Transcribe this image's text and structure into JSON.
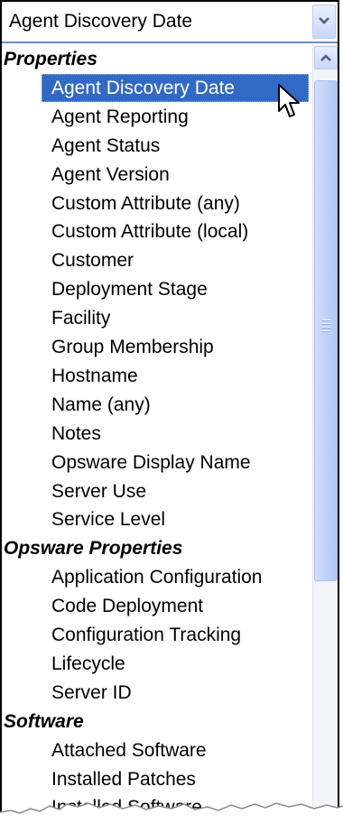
{
  "combo": {
    "value": "Agent Discovery Date"
  },
  "list": {
    "items": [
      {
        "type": "group",
        "label": "Properties"
      },
      {
        "type": "option",
        "label": "Agent Discovery Date",
        "selected": true
      },
      {
        "type": "option",
        "label": "Agent Reporting"
      },
      {
        "type": "option",
        "label": "Agent Status"
      },
      {
        "type": "option",
        "label": "Agent Version"
      },
      {
        "type": "option",
        "label": "Custom Attribute (any)"
      },
      {
        "type": "option",
        "label": "Custom Attribute (local)"
      },
      {
        "type": "option",
        "label": "Customer"
      },
      {
        "type": "option",
        "label": "Deployment Stage"
      },
      {
        "type": "option",
        "label": "Facility"
      },
      {
        "type": "option",
        "label": "Group Membership"
      },
      {
        "type": "option",
        "label": "Hostname"
      },
      {
        "type": "option",
        "label": "Name (any)"
      },
      {
        "type": "option",
        "label": "Notes"
      },
      {
        "type": "option",
        "label": "Opsware Display Name"
      },
      {
        "type": "option",
        "label": "Server Use"
      },
      {
        "type": "option",
        "label": "Service Level"
      },
      {
        "type": "group",
        "label": "Opsware Properties"
      },
      {
        "type": "option",
        "label": "Application Configuration"
      },
      {
        "type": "option",
        "label": "Code Deployment"
      },
      {
        "type": "option",
        "label": "Configuration Tracking"
      },
      {
        "type": "option",
        "label": "Lifecycle"
      },
      {
        "type": "option",
        "label": "Server ID"
      },
      {
        "type": "group",
        "label": "Software"
      },
      {
        "type": "option",
        "label": "Attached Software"
      },
      {
        "type": "option",
        "label": "Installed Patches"
      },
      {
        "type": "option",
        "label": "Installed Software"
      }
    ]
  },
  "icons": {
    "combo_button": "chevron-down-icon",
    "scroll_up": "chevron-up-icon",
    "cursor": "mouse-pointer-icon"
  },
  "colors": {
    "selection": "#3169c6",
    "selection_text": "#ffffff",
    "scroll_thumb": "#bcd0f7"
  }
}
